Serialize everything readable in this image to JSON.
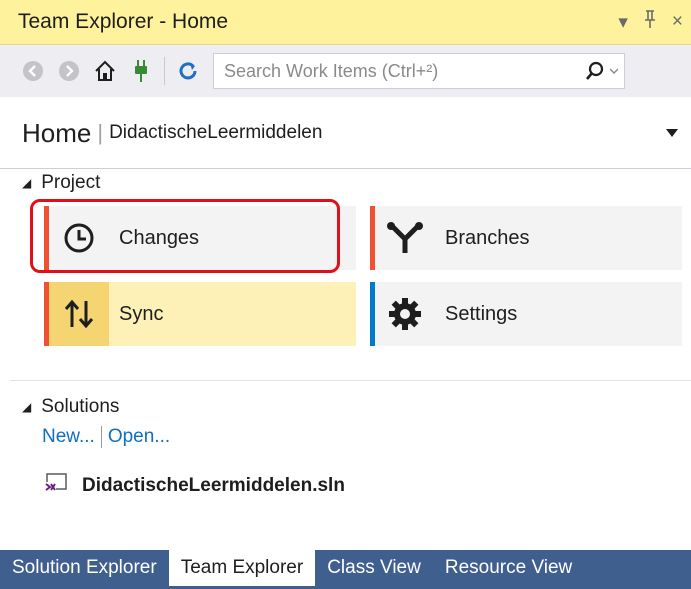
{
  "window": {
    "title": "Team Explorer - Home",
    "controls": {
      "dropdown": "▾",
      "pin": "⊥",
      "close": "×"
    }
  },
  "toolbar": {
    "search_placeholder": "Search Work Items (Ctrl+²)",
    "icons": [
      "back-icon",
      "forward-icon",
      "home-icon",
      "connect-icon",
      "refresh-icon",
      "search-icon"
    ]
  },
  "header": {
    "title": "Home",
    "separator": "|",
    "project": "DidactischeLeermiddelen"
  },
  "project_section": {
    "label": "Project",
    "tiles": [
      {
        "label": "Changes",
        "icon": "clock-icon",
        "accent": "#f05133"
      },
      {
        "label": "Branches",
        "icon": "branch-icon",
        "accent": "#f05133"
      },
      {
        "label": "Sync",
        "icon": "sync-arrows-icon",
        "accent": "#f05133"
      },
      {
        "label": "Settings",
        "icon": "gear-icon",
        "accent": "#007acc"
      }
    ]
  },
  "solutions_section": {
    "label": "Solutions",
    "new_link": "New...",
    "open_link": "Open...",
    "solution_file": "DidactischeLeermiddelen.sln"
  },
  "bottom_tabs": [
    {
      "label": "Solution Explorer",
      "active": false
    },
    {
      "label": "Team Explorer",
      "active": true
    },
    {
      "label": "Class View",
      "active": false
    },
    {
      "label": "Resource View",
      "active": false
    }
  ]
}
